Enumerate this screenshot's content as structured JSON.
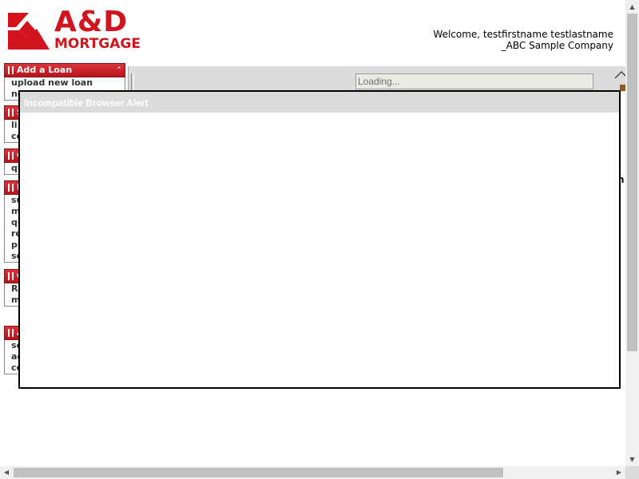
{
  "logo": {
    "line1": "A&D",
    "line2": "MORTGAGE",
    "brand_color": "#d2141e"
  },
  "welcome": {
    "line1": "Welcome, testfirstname testlastname",
    "line2": "_ABC Sample Company"
  },
  "sidebar": {
    "groups": [
      {
        "title": "Add a Loan",
        "items": [
          "upload new loan",
          "ne"
        ]
      },
      {
        "title": "S",
        "items": [
          "li",
          "co"
        ]
      },
      {
        "title": "C",
        "items": [
          "qu"
        ]
      },
      {
        "title": "L",
        "items": [
          "su",
          "m",
          "qu",
          "re",
          "pr",
          "se"
        ]
      },
      {
        "title": "C",
        "items": [
          "R",
          "m"
        ]
      },
      {
        "title": "A",
        "items": [
          "se",
          "ac",
          "co"
        ]
      }
    ]
  },
  "main": {
    "loading_value": "Loading...",
    "edge_fragment_1": "n",
    "edge_fragment_2": "i"
  },
  "modal": {
    "title": "Incompatible Browser Alert"
  },
  "colors": {
    "sidebar_header": "#c41e26",
    "modal_title_bg": "#dcdcdc",
    "toolbar_bg": "#dcdcdc"
  }
}
